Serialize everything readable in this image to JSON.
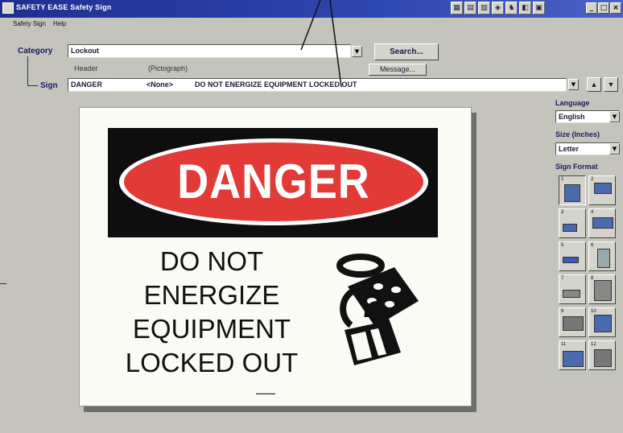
{
  "window": {
    "title": "SAFETY EASE Safety Sign",
    "toolbar_icons": [
      "toolbar-icon-1",
      "toolbar-icon-2",
      "toolbar-icon-3",
      "toolbar-icon-4",
      "toolbar-icon-5",
      "toolbar-icon-6",
      "toolbar-icon-7"
    ],
    "controls": {
      "minimize": "_",
      "maximize": "□",
      "close": "×"
    }
  },
  "menu": {
    "items": [
      "Safety Sign",
      "Help"
    ]
  },
  "category": {
    "label": "Category",
    "value": "Lockout",
    "search_button": "Search..."
  },
  "sign": {
    "label": "Sign",
    "header_label": "Header",
    "pictograph_label": "(Pictograph)",
    "message_button": "Message...",
    "header_value": "DANGER",
    "pictograph_value": "<None>",
    "message_value": "DO NOT ENERGIZE EQUIPMENT LOCKED OUT"
  },
  "preview": {
    "header_text": "DANGER",
    "message_lines": [
      "DO NOT",
      "ENERGIZE",
      "EQUIPMENT",
      "LOCKED OUT"
    ],
    "pictograph_icon": "padlock-hasp-icon",
    "colors": {
      "header_band": "#0e0e0e",
      "danger_red": "#e23a36"
    }
  },
  "right_panel": {
    "language_label": "Language",
    "language_value": "English",
    "size_label": "Size (Inches)",
    "size_value": "Letter",
    "format_label": "Sign Format",
    "formats": [
      "1",
      "2",
      "3",
      "4",
      "5",
      "6",
      "7",
      "8",
      "9",
      "10",
      "11",
      "12"
    ]
  }
}
